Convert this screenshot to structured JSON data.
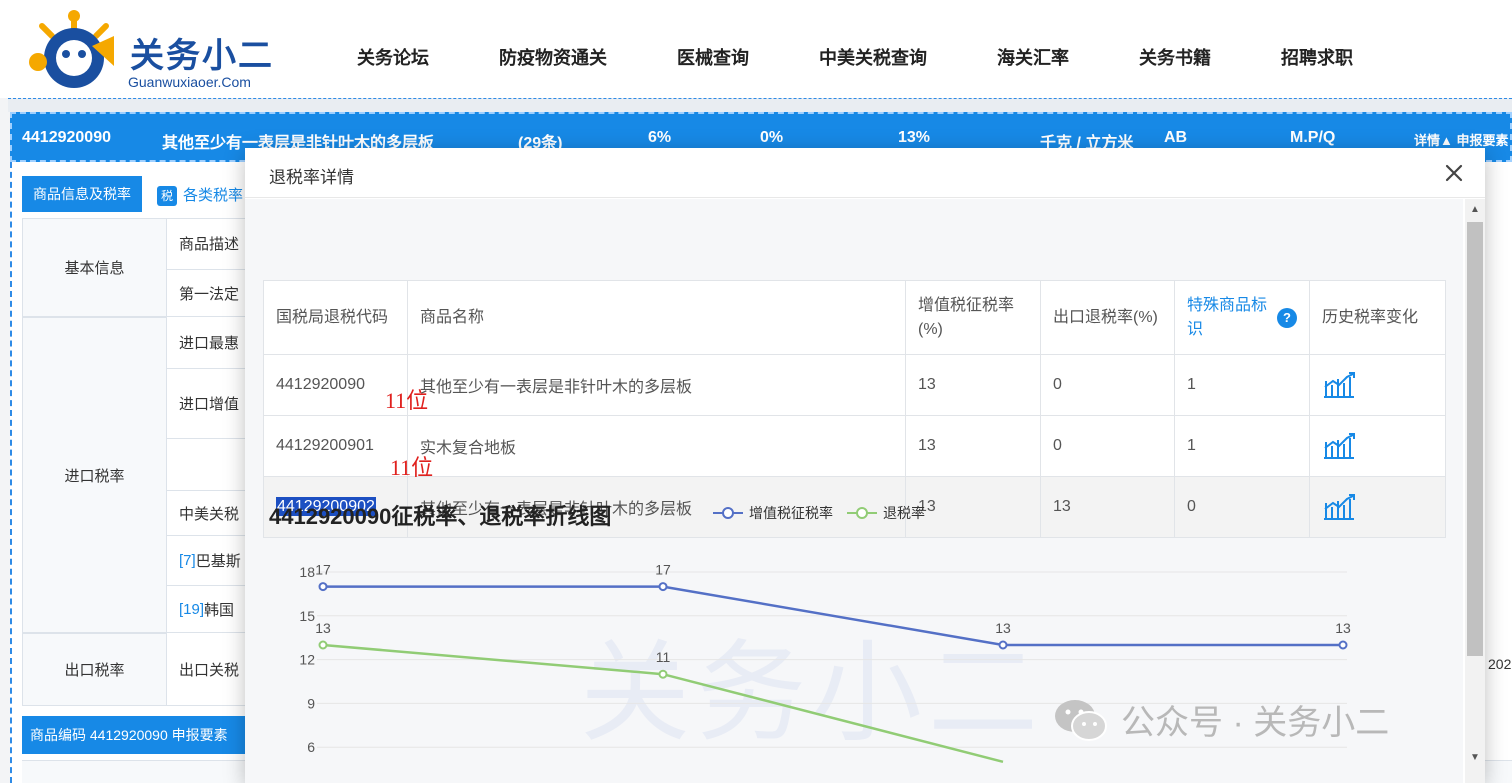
{
  "site": {
    "logo_cn": "关务小二",
    "logo_en": "Guanwuxiaoer.Com",
    "nav": [
      "关务论坛",
      "防疫物资通关",
      "医械查询",
      "中美关税查询",
      "海关汇率",
      "关务书籍",
      "招聘求职"
    ]
  },
  "hs_row": {
    "code": "4412920090",
    "name": "其他至少有一表层是非针叶木的多层板",
    "count": "(29条)",
    "rate1": "6%",
    "rate2": "0%",
    "rate3": "13%",
    "unit": "千克 / 立方米",
    "supervision": "AB",
    "inspection": "M.P/Q",
    "detail": "详情▲ 申报要素"
  },
  "page": {
    "tab_active": "商品信息及税率",
    "tab_link": "各类税率",
    "tax_badge": "税",
    "sections": {
      "basic": "基本信息",
      "import": "进口税率",
      "export": "出口税率"
    },
    "rows": [
      "商品描述",
      "第一法定",
      "进口最惠",
      "进口增值",
      "",
      "中美关税",
      "巴基斯",
      "韩国",
      "出口关税"
    ],
    "row_links": [
      "[7]",
      "[19]"
    ],
    "decl_bar": "商品编码 4412920090 申报要素",
    "right_fragment": "202"
  },
  "modal": {
    "title": "退税率详情",
    "columns": [
      "国税局退税代码",
      "商品名称",
      "增值税征税率(%)",
      "出口退税率(%)",
      "特殊商品标识",
      "历史税率变化"
    ],
    "rows": [
      {
        "code": "4412920090",
        "name": "其他至少有一表层是非针叶木的多层板",
        "vat": "13",
        "refund": "0",
        "special": "1"
      },
      {
        "code": "44129200901",
        "name": "实木复合地板",
        "vat": "13",
        "refund": "0",
        "special": "1"
      },
      {
        "code": "44129200902",
        "name": "其他至少有一表层是非针叶木的多层板",
        "vat": "13",
        "refund": "13",
        "special": "0"
      }
    ],
    "annotations": [
      "11位",
      "11位"
    ],
    "chart_title": "4412920090征税率、退税率折线图",
    "wechat": "公众号 · 关务小二",
    "watermark": "关务小二"
  },
  "colors": {
    "primary": "#1789e6",
    "vat_line": "#5470c6",
    "refund_line": "#91cc75",
    "annotation": "#e0211e"
  },
  "chart_data": {
    "type": "line",
    "title": "4412920090征税率、退税率折线图",
    "xlabel": "",
    "ylabel": "",
    "y_ticks": [
      "18",
      "15",
      "12",
      "9",
      "6"
    ],
    "ylim": [
      3,
      18
    ],
    "legend_position": "top",
    "series": [
      {
        "name": "增值税征税率",
        "values": [
          17,
          17,
          13,
          13
        ],
        "labels": [
          "17",
          "17",
          "13",
          "13"
        ],
        "color": "#5470c6"
      },
      {
        "name": "退税率",
        "values": [
          13,
          11,
          5,
          null
        ],
        "labels": [
          "13",
          "11",
          "",
          ""
        ],
        "color": "#91cc75"
      }
    ]
  }
}
